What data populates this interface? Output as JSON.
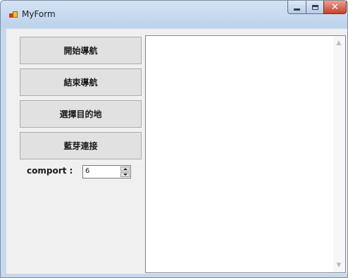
{
  "window": {
    "title": "MyForm",
    "icon": "winforms-app-icon",
    "caption_buttons": [
      "minimize-icon",
      "maximize-icon",
      "close-icon"
    ]
  },
  "buttons": {
    "start_navigation": "開始導航",
    "end_navigation": "結束導航",
    "select_destination": "選擇目的地",
    "bluetooth_connect": "藍芽連接"
  },
  "comport": {
    "label": "comport :",
    "value": "6"
  },
  "output_box": {
    "text": ""
  },
  "colors": {
    "titlebar": "#c6d8ec",
    "client_background": "#f0f0f0",
    "close_button": "#c6432c"
  }
}
